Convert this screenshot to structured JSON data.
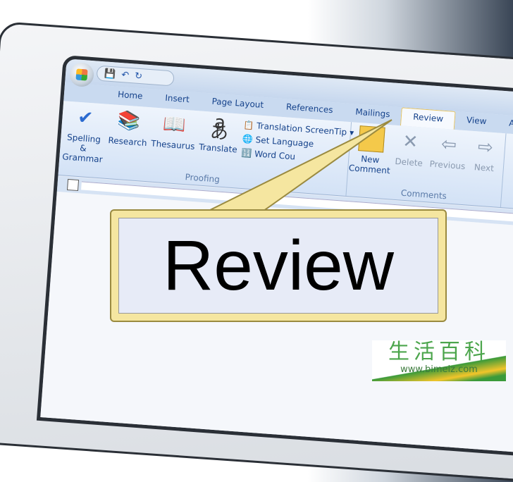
{
  "tabs": [
    "Home",
    "Insert",
    "Page Layout",
    "References",
    "Mailings",
    "Review",
    "View",
    "Acroba"
  ],
  "active_tab": "Review",
  "proofing": {
    "label": "Proofing",
    "spelling": "Spelling &",
    "grammar": "Grammar",
    "research": "Research",
    "thesaurus": "Thesaurus",
    "translate": "Translate",
    "screentip": "Translation ScreenTip",
    "set_language": "Set Language",
    "word_count": "Word Cou"
  },
  "comments": {
    "label": "Comments",
    "new1": "New",
    "new2": "Comment",
    "delete": "Delete",
    "previous": "Previous",
    "next": "Next"
  },
  "callout": "Review",
  "watermark": {
    "chinese": "生活百科",
    "url": "www.bimeiz.com"
  },
  "colors": {
    "callout_fill": "#f5e6a0",
    "tab_text": "#15428b"
  }
}
